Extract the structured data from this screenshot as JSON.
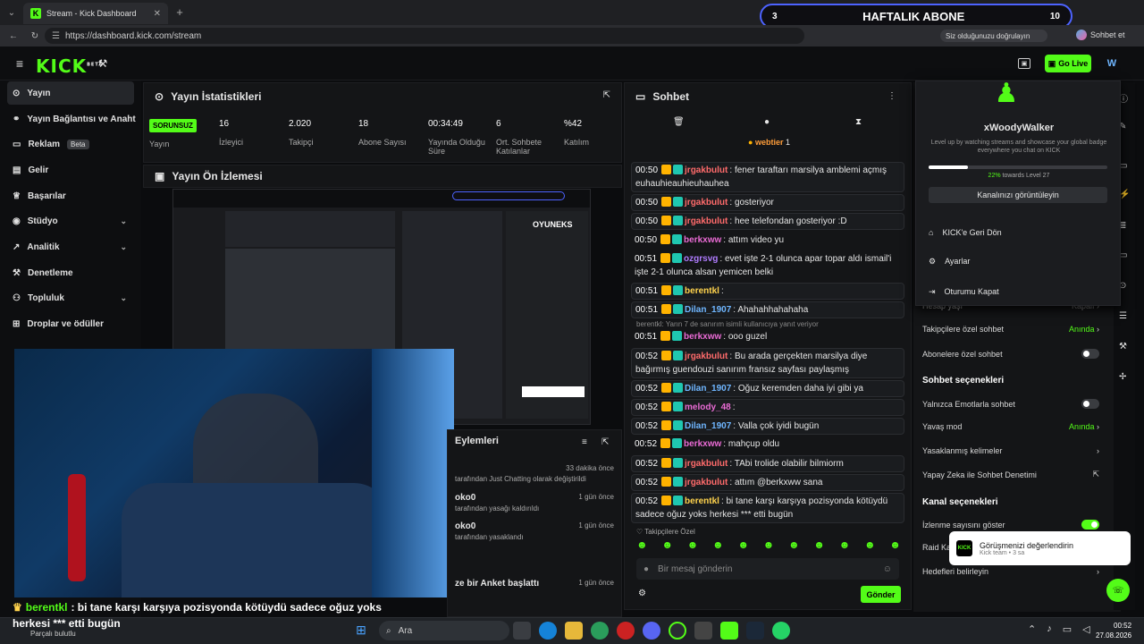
{
  "browser": {
    "tab_title": "Stream - Kick Dashboard",
    "url": "https://dashboard.kick.com/stream",
    "sign_in_prompt": "Siz olduğunuzu doğrulayın",
    "profile_label": "Sohbet et"
  },
  "sub_goal": {
    "left": "3",
    "title": "HAFTALIK ABONE",
    "right": "10"
  },
  "topnav": {
    "logo": "KICK",
    "beta": "BETA",
    "go_live": "Go Live"
  },
  "sidebar": {
    "items": [
      {
        "label": "Yayın"
      },
      {
        "label": "Yayın Bağlantısı ve Anahtarı"
      },
      {
        "label": "Reklam",
        "badge": "Beta"
      },
      {
        "label": "Gelir"
      },
      {
        "label": "Başarılar"
      },
      {
        "label": "Stüdyo"
      },
      {
        "label": "Analitik"
      },
      {
        "label": "Denetleme"
      },
      {
        "label": "Topluluk"
      },
      {
        "label": "Droplar ve ödüller"
      }
    ]
  },
  "stats": {
    "title": "Yayın İstatistikleri",
    "status_badge": "SORUNSUZ",
    "items": [
      {
        "value": "",
        "label": "Yayın"
      },
      {
        "value": "16",
        "label": "İzleyici"
      },
      {
        "value": "2.020",
        "label": "Takipçi"
      },
      {
        "value": "18",
        "label": "Abone Sayısı"
      },
      {
        "value": "00:34:49",
        "label": "Yayında Olduğu Süre"
      },
      {
        "value": "6",
        "label": "Ort. Sohbete Katılanlar"
      },
      {
        "value": "%42",
        "label": "Katılım"
      }
    ]
  },
  "preview": {
    "title": "Yayın Ön İzlemesi"
  },
  "actions": {
    "title": "Eylemleri",
    "items": [
      {
        "time": "33 dakika önce",
        "text": "tarafından Just Chatting olarak değiştirildi"
      },
      {
        "user": "oko0",
        "time": "1 gün önce",
        "text": "tarafından yasağı kaldırıldı"
      },
      {
        "user": "oko0",
        "time": "1 gün önce",
        "text": "tarafından yasaklandı"
      },
      {
        "user": "ze bir Anket başlattı",
        "time": "1 gün önce",
        "text": ""
      }
    ]
  },
  "chat": {
    "title": "Sohbet",
    "pinned_user": "webtier",
    "pinned_count": "1",
    "reply_note": "berentkl: Yarın 7 de sanırım isimli kullanıcıya yanıt veriyor",
    "followers_only_label": "Takipçilere Özel",
    "input_placeholder": "Bir mesaj gönderin",
    "send_label": "Gönder",
    "messages": [
      {
        "time": "00:50",
        "user": "jrgakbulut",
        "color": "#ff6b6b",
        "text": "fener taraftarı marsilya amblemi açmış euhauhieauhieuhauhea"
      },
      {
        "time": "00:50",
        "user": "jrgakbulut",
        "color": "#ff6b6b",
        "text": "gosteriyor"
      },
      {
        "time": "00:50",
        "user": "jrgakbulut",
        "color": "#ff6b6b",
        "text": "hee telefondan gosteriyor :D"
      },
      {
        "time": "00:50",
        "user": "berkxww",
        "color": "#e96bd4",
        "text": "attım video yu"
      },
      {
        "time": "00:51",
        "user": "ozgrsvg",
        "color": "#b07cff",
        "text": "evet işte 2-1 olunca apar topar aldı ismail'i işte 2-1 olunca alsan yemicen belki"
      },
      {
        "time": "00:51",
        "user": "berentkl",
        "color": "#ffd34d",
        "text": ""
      },
      {
        "time": "00:51",
        "user": "Dilan_1907",
        "color": "#6fb6ff",
        "text": "Ahahahhahahaha"
      },
      {
        "time": "00:51",
        "user": "berkxww",
        "color": "#e96bd4",
        "text": "ooo guzel"
      },
      {
        "time": "00:52",
        "user": "jrgakbulut",
        "color": "#ff6b6b",
        "text": "Bu arada gerçekten marsilya diye bağırmış guendouzi sanırım fransız sayfası paylaşmış"
      },
      {
        "time": "00:52",
        "user": "Dilan_1907",
        "color": "#6fb6ff",
        "text": "Oğuz keremden daha iyi gibi ya"
      },
      {
        "time": "00:52",
        "user": "melody_48",
        "color": "#e96bd4",
        "text": ""
      },
      {
        "time": "00:52",
        "user": "Dilan_1907",
        "color": "#6fb6ff",
        "text": "Valla çok iyidi bugün"
      },
      {
        "time": "00:52",
        "user": "berkxww",
        "color": "#e96bd4",
        "text": "mahçup oldu"
      },
      {
        "time": "00:52",
        "user": "jrgakbulut",
        "color": "#ff6b6b",
        "text": "TAbi trolide olabilir bilmiorm"
      },
      {
        "time": "00:52",
        "user": "jrgakbulut",
        "color": "#ff6b6b",
        "text": "attım @berkxww sana"
      },
      {
        "time": "00:52",
        "user": "berentkl",
        "color": "#ffd34d",
        "text": "bi tane karşı karşıya pozisyonda kötüydü sadece oğuz yoks herkesi *** etti bugün"
      }
    ]
  },
  "profile_menu": {
    "username": "xWoodyWalker",
    "description": "Level up by watching streams and showcase your global badge everywhere you chat on KICK",
    "progress": 0.22,
    "progress_label": "22%",
    "progress_suffix": "towards Level 27",
    "view_channel": "Kanalınızı görüntüleyin",
    "back_to_kick": "KICK'e Geri Dön",
    "settings": "Ayarlar",
    "logout": "Oturumu Kapat"
  },
  "settings_panel": {
    "account_age": "Hesap yaşı",
    "account_age_value": "Kapalı",
    "followers_chat": "Takipçilere özel sohbet",
    "followers_chat_value": "Anında",
    "subs_chat": "Abonelere özel sohbet",
    "chat_options_title": "Sohbet seçenekleri",
    "emote_only": "Yalnızca Emotlarla sohbet",
    "slow_mode": "Yavaş mod",
    "slow_mode_value": "Anında",
    "banned_words": "Yasaklanmış kelimeler",
    "ai_moderation": "Yapay Zeka ile Sohbet Denetimi",
    "channel_options_title": "Kanal seçenekleri",
    "show_viewers": "İzlenme sayısını göster",
    "raid": "Raid Ka",
    "goals": "Hedefleri belirleyin"
  },
  "toast": {
    "title": "Görüşmenizi değerlendirin",
    "subtitle": "Kick team • 3 sa"
  },
  "overlay": {
    "caption_user": "berentkl",
    "caption_text": ": bi tane karşı karşıya pozisyonda kötüydü sadece oğuz yoks",
    "caption_line2": "herkesi *** etti bugün",
    "status": "Parçalı bulutlu",
    "overlay_brand": "OYUNEKS"
  },
  "taskbar": {
    "search": "Ara",
    "time": "00:52",
    "date": "27.08.2026"
  },
  "colors": {
    "accent": "#53fc18",
    "sub_goal_border": "#4d63ff"
  }
}
